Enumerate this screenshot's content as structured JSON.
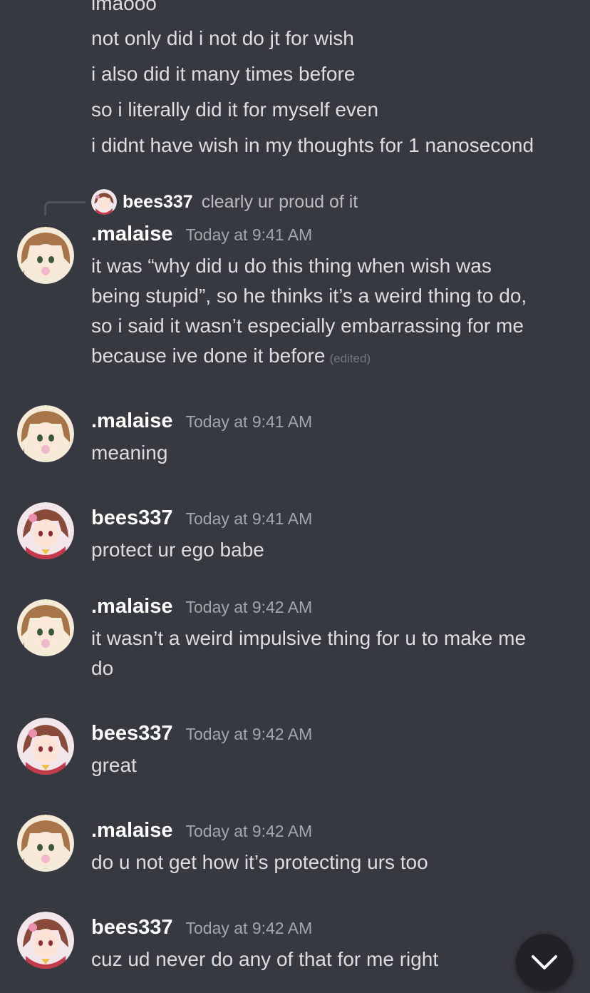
{
  "continuation": {
    "lines": [
      "lmaooo",
      "not only did i not do jt for wish",
      "i also did it many times before",
      "so i literally did it for myself even",
      "i didnt have wish in my thoughts for 1 nanosecond"
    ]
  },
  "reply": {
    "username": "bees337",
    "text": "clearly ur proud of it"
  },
  "messages": [
    {
      "username": ".malaise",
      "timestamp": "Today at 9:41 AM",
      "lines": [
        "it was “why did u do this thing when wish was",
        "being stupid”, so he thinks it’s a weird thing to do,",
        "so i said it wasn’t especially embarrassing for me",
        "because ive done it before"
      ],
      "edited": "(edited)"
    },
    {
      "username": ".malaise",
      "timestamp": "Today at 9:41 AM",
      "lines": [
        "meaning"
      ]
    },
    {
      "username": "bees337",
      "timestamp": "Today at 9:41 AM",
      "lines": [
        "protect ur ego babe"
      ]
    },
    {
      "username": ".malaise",
      "timestamp": "Today at 9:42 AM",
      "lines": [
        "it wasn’t a weird impulsive thing for u to make me",
        "do"
      ]
    },
    {
      "username": "bees337",
      "timestamp": "Today at 9:42 AM",
      "lines": [
        "great"
      ]
    },
    {
      "username": ".malaise",
      "timestamp": "Today at 9:42 AM",
      "lines": [
        "do u not get how it’s protecting urs too"
      ]
    },
    {
      "username": "bees337",
      "timestamp": "Today at 9:42 AM",
      "lines": [
        "cuz ud never do any of that for me right"
      ]
    }
  ],
  "icons": {
    "jump_to_present": "chevron-down-icon",
    "malaise_avatar": "brown-haired-anime-avatar",
    "bees_avatar": "pink-anime-avatar"
  },
  "colors": {
    "background": "#36393f",
    "text": "#dcddde",
    "username": "#ffffff",
    "timestamp": "#a3a6aa",
    "jump_button": "#202225"
  }
}
